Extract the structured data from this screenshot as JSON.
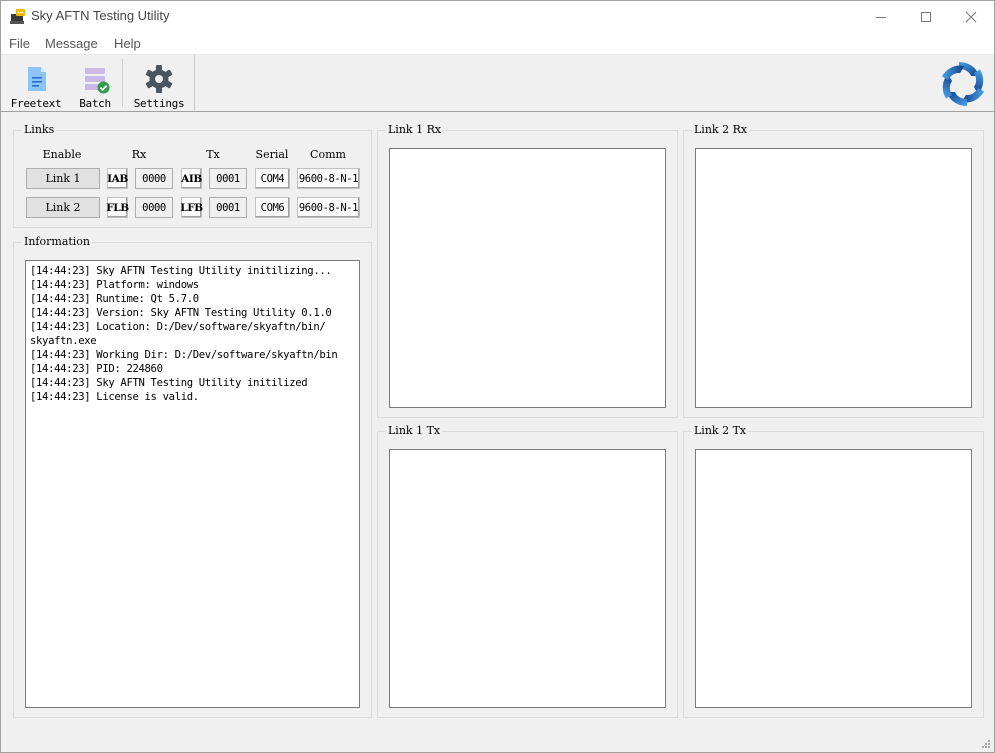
{
  "window": {
    "title": "Sky AFTN Testing Utility",
    "controls": {
      "minimize": "minimize",
      "maximize": "maximize",
      "close": "close"
    }
  },
  "menu": [
    "File",
    "Message",
    "Help"
  ],
  "toolbar": {
    "items": [
      {
        "label": "Freetext",
        "icon": "document-icon"
      },
      {
        "label": "Batch",
        "icon": "batch-check-icon"
      },
      {
        "label": "Settings",
        "icon": "gear-icon"
      }
    ],
    "colors": {
      "document": "#8cc4f8",
      "batch": "#c9b8e6",
      "check": "#2f9e4a",
      "gear": "#4a5560",
      "logo": "#1d5fb0"
    }
  },
  "links": {
    "title": "Links",
    "headers": {
      "enable": "Enable",
      "rx": "Rx",
      "tx": "Tx",
      "serial": "Serial",
      "comm": "Comm"
    },
    "rows": [
      {
        "enable": "Link 1",
        "rx_addr": "IAB",
        "rx_seq": "0000",
        "tx_addr": "AIB",
        "tx_seq": "0001",
        "serial": "COM4",
        "comm": "9600-8-N-1"
      },
      {
        "enable": "Link 2",
        "rx_addr": "FLB",
        "rx_seq": "0000",
        "tx_addr": "LFB",
        "tx_seq": "0001",
        "serial": "COM6",
        "comm": "9600-8-N-1"
      }
    ]
  },
  "information": {
    "title": "Information",
    "log": "[14:44:23] Sky AFTN Testing Utility initilizing...\n[14:44:23] Platform: windows\n[14:44:23] Runtime: Qt 5.7.0\n[14:44:23] Version: Sky AFTN Testing Utility 0.1.0\n[14:44:23] Location: D:/Dev/software/skyaftn/bin/\nskyaftn.exe\n[14:44:23] Working Dir: D:/Dev/software/skyaftn/bin\n[14:44:23] PID: 224860\n[14:44:23] Sky AFTN Testing Utility initilized\n[14:44:23] License is valid."
  },
  "panels": {
    "link1_rx": {
      "title": "Link 1 Rx",
      "content": ""
    },
    "link2_rx": {
      "title": "Link 2 Rx",
      "content": ""
    },
    "link1_tx": {
      "title": "Link 1 Tx",
      "content": ""
    },
    "link2_tx": {
      "title": "Link 2 Tx",
      "content": ""
    }
  }
}
